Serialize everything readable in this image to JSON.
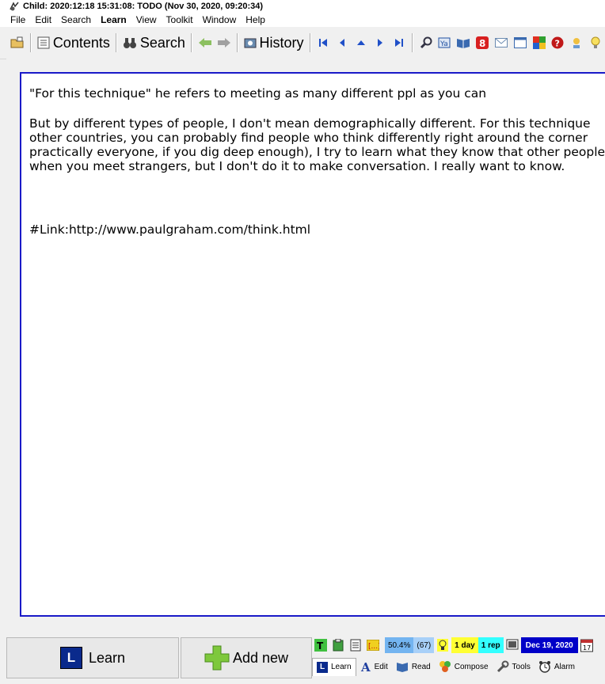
{
  "window": {
    "title": "Child: 2020:12:18 15:31:08: TODO (Nov 30, 2020, 09:20:34)"
  },
  "menu": [
    "File",
    "Edit",
    "Search",
    "Learn",
    "View",
    "Toolkit",
    "Window",
    "Help"
  ],
  "toolbar": {
    "contents_label": "Contents",
    "search_label": "Search",
    "history_label": "History"
  },
  "editor": {
    "line1": "\"For this technique\" he refers to meeting as many different ppl as you can",
    "para2": [
      "But by different types of people, I don't mean demographically different. For this technique",
      "other countries, you can probably find people who think differently right around the corner",
      "practically everyone, if you dig deep enough), I try to learn what they know that other people",
      "when you meet strangers, but I don't do it to make conversation. I really want to know."
    ],
    "link": "#Link:http://www.paulgraham.com/think.html"
  },
  "bottom": {
    "learn_label": "Learn",
    "learn_letter": "L",
    "addnew_label": "Add new",
    "status": {
      "percent": "50.4%",
      "count": "(67)",
      "day": "1 day",
      "rep": "1 rep",
      "date": "Dec 19, 2020",
      "cal_day": "17"
    },
    "tabs": [
      "Learn",
      "Edit",
      "Read",
      "Compose",
      "Tools",
      "Alarm"
    ],
    "tab_learn_letter": "L"
  },
  "colors": {
    "editor_border": "#1a1ac8",
    "percent_bg": "#73b4f0",
    "day_bg": "#ffff33",
    "rep_bg": "#33ffff",
    "date_bg": "#0000c8"
  }
}
